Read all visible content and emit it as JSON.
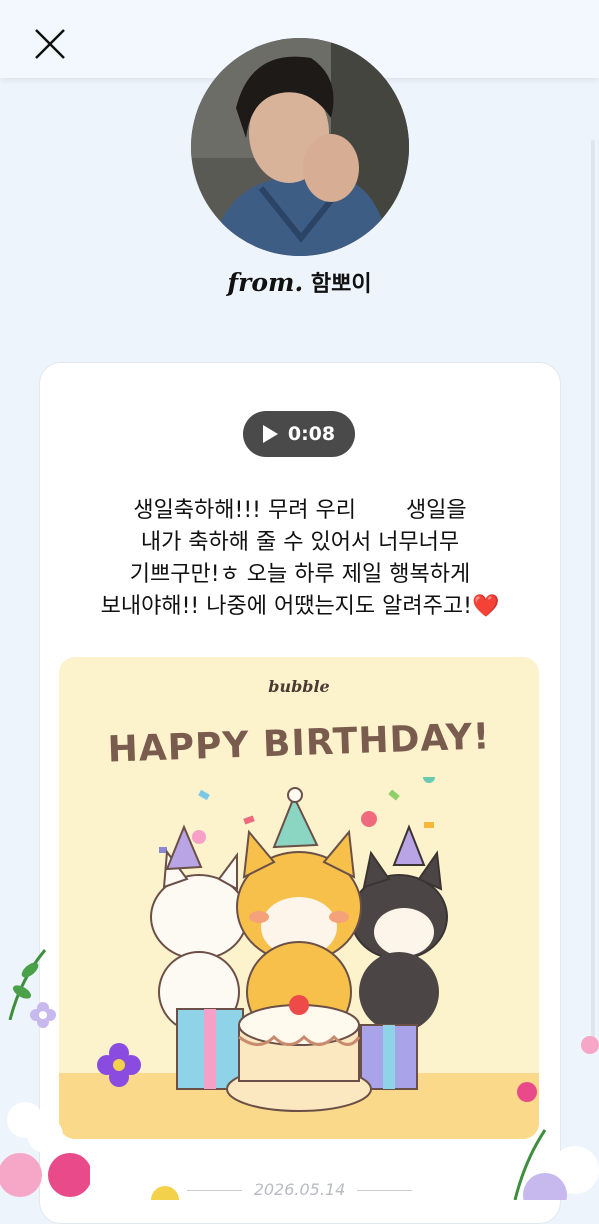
{
  "header": {
    "close_icon": "close-icon"
  },
  "sender": {
    "from_prefix": "from.",
    "name": "함뽀이"
  },
  "voice_message": {
    "duration": "0:08"
  },
  "message": {
    "line1a": "생일축하해!!! 무려 우리",
    "line1b": "생일을",
    "line2": "내가 축하해 줄 수 있어서 너무너무",
    "line3": "기쁘구만!ㅎ 오늘 하루 제일 행복하게",
    "line4": "보내야해!! 나중에 어땠는지도 알려주고!",
    "emoji": "❤️"
  },
  "birthday_card": {
    "brand": "bubble",
    "title": "HAPPY BIRTHDAY!"
  },
  "date": "2026.05.14",
  "colors": {
    "background": "#eef4fc",
    "card_bg": "#fcf2cc",
    "title": "#7a5c4f",
    "pill": "#4a4a4a"
  }
}
